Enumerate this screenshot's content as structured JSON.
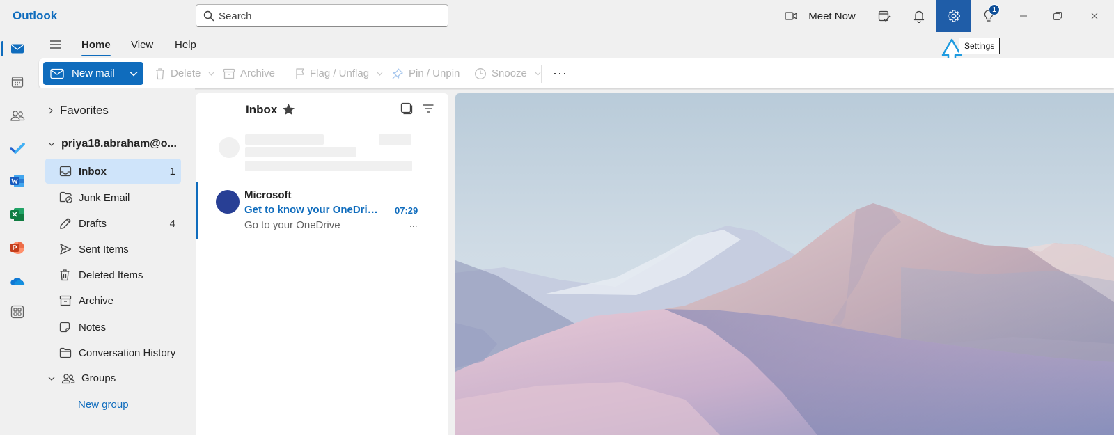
{
  "app": {
    "title": "Outlook"
  },
  "search": {
    "placeholder": "Search"
  },
  "titlebar": {
    "meet_now_label": "Meet Now",
    "tips_badge": "1",
    "settings_tooltip": "Settings"
  },
  "ribbon": {
    "tabs": [
      {
        "label": "Home",
        "selected": true
      },
      {
        "label": "View",
        "selected": false
      },
      {
        "label": "Help",
        "selected": false
      }
    ],
    "new_mail_label": "New mail",
    "delete_label": "Delete",
    "archive_label": "Archive",
    "flag_label": "Flag / Unflag",
    "pin_label": "Pin / Unpin",
    "snooze_label": "Snooze",
    "more_label": "···"
  },
  "folders": {
    "favorites_label": "Favorites",
    "account_label": "priya18.abraham@o...",
    "items": [
      {
        "label": "Inbox",
        "count": "1",
        "selected": true
      },
      {
        "label": "Junk Email",
        "count": ""
      },
      {
        "label": "Drafts",
        "count": "4"
      },
      {
        "label": "Sent Items",
        "count": ""
      },
      {
        "label": "Deleted Items",
        "count": ""
      },
      {
        "label": "Archive",
        "count": ""
      },
      {
        "label": "Notes",
        "count": ""
      },
      {
        "label": "Conversation History",
        "count": ""
      }
    ],
    "groups_label": "Groups",
    "new_group_label": "New group"
  },
  "message_list": {
    "title": "Inbox",
    "messages": [
      {
        "sender": "Microsoft",
        "subject": "Get to know your OneDrive ...",
        "time": "07:29",
        "preview": "Go to your OneDrive",
        "more": "..."
      }
    ]
  },
  "colors": {
    "accent": "#0f6cbd",
    "settings_active_bg": "#1f5da8",
    "selected_folder_bg": "#cfe4fa",
    "annotation_arrow": "#1e9be0"
  },
  "icons": {
    "rail": [
      "mail-icon",
      "calendar-icon",
      "people-icon",
      "todo-icon",
      "word-icon",
      "excel-icon",
      "powerpoint-icon",
      "onedrive-icon",
      "apps-icon"
    ]
  }
}
